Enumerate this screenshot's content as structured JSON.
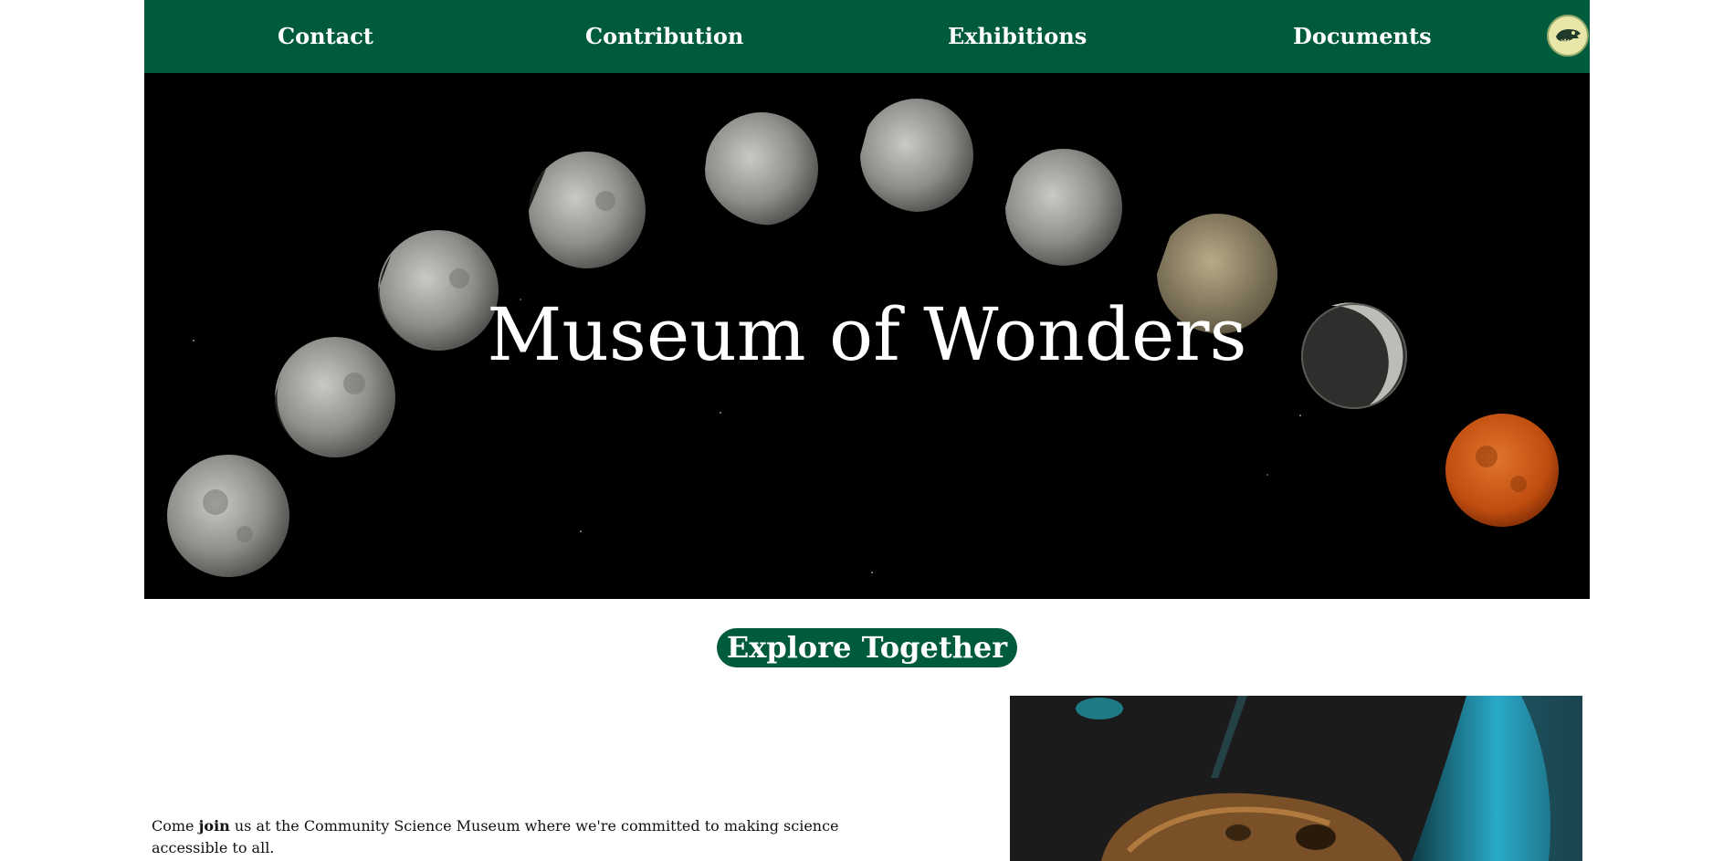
{
  "nav": {
    "items": [
      {
        "label": "Contact"
      },
      {
        "label": "Contribution"
      },
      {
        "label": "Exhibitions"
      },
      {
        "label": "Documents"
      }
    ],
    "logo_icon": "dinosaur-skull-logo-icon"
  },
  "hero": {
    "title": "Museum of Wonders",
    "image": "lunar-eclipse-phases-image"
  },
  "section": {
    "heading": "Explore Together",
    "intro_before": "Come ",
    "intro_bold": "join",
    "intro_after": " us at the Community Science Museum where we're committed to making science accessible to all.",
    "photo": "dinosaur-skull-exhibit-photo"
  },
  "colors": {
    "brand_green": "#005a3c",
    "white": "#ffffff",
    "hero_bg": "#000000"
  }
}
